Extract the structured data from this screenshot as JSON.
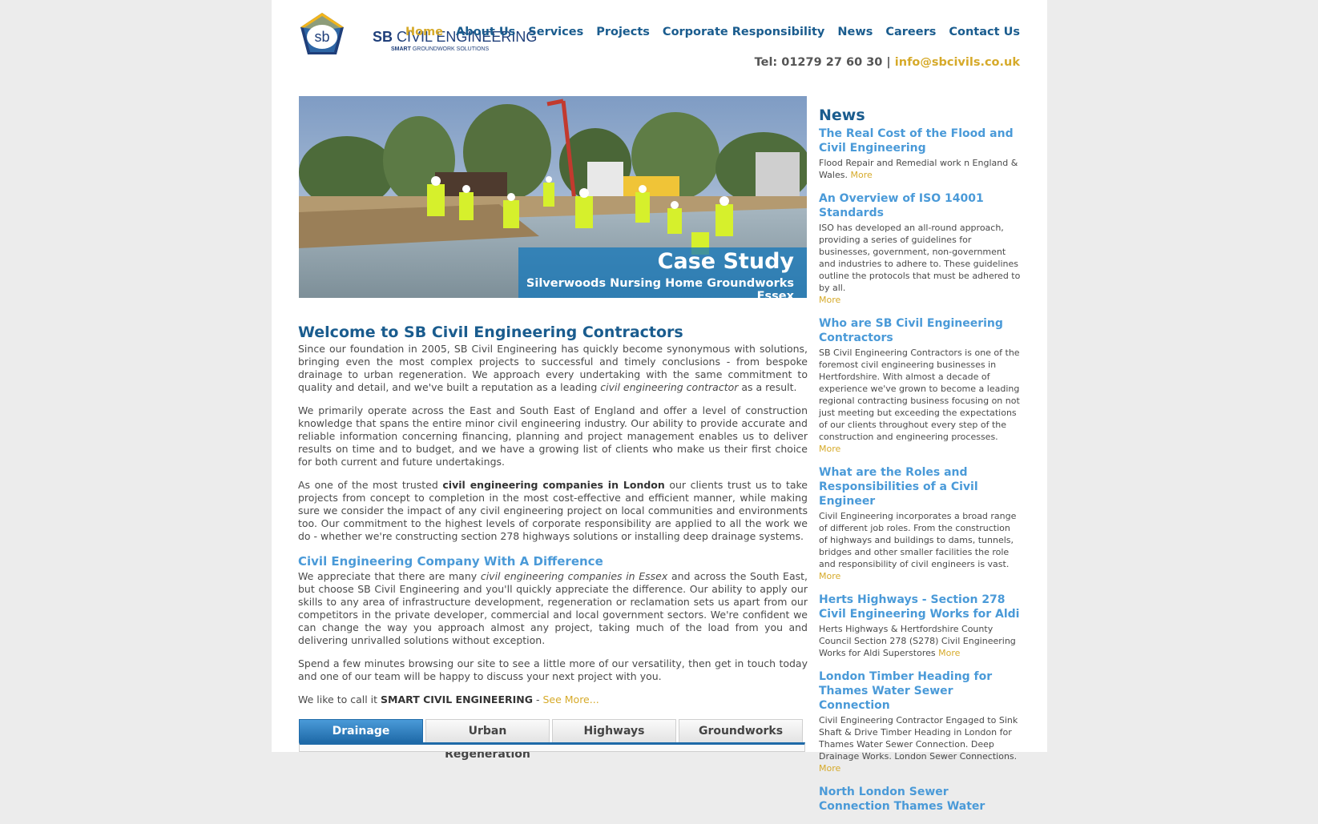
{
  "header": {
    "logo_mark": "sb",
    "logo_title_bold": "SB",
    "logo_title_rest": " CIVIL ENGINEERING",
    "logo_sub_bold": "SMART",
    "logo_sub_rest": " GROUNDWORK SOLUTIONS",
    "nav": [
      "Home",
      "About Us",
      "Services",
      "Projects",
      "Corporate Responsibility",
      "News",
      "Careers",
      "Contact Us"
    ],
    "tel": "Tel: 01279 27 60 30 |",
    "email": "info@sbcivils.co.uk"
  },
  "hero": {
    "title": "Case Study",
    "subtitle": "Silverwoods Nursing Home Groundworks Essex"
  },
  "main": {
    "heading": "Welcome to SB Civil Engineering Contractors",
    "p1_a": "Since our foundation in 2005, SB Civil Engineering has quickly become synonymous with solutions, bringing even the most complex projects to successful and timely conclusions - from bespoke drainage to urban regeneration. We approach every undertaking with the same commitment to quality and detail, and we've built a reputation as a leading ",
    "p1_i": "civil engineering contractor",
    "p1_b": " as a result.",
    "p2": "We primarily operate across the East and South East of England and offer a level of construction knowledge that spans the entire minor civil engineering industry. Our ability to provide accurate and reliable information concerning financing, planning and project management enables us to deliver results on time and to budget, and we have a growing list of clients who make us their first choice for both current and future undertakings.",
    "p3_a": "As one of the most trusted ",
    "p3_b": "civil engineering companies in London",
    "p3_c": " our clients trust us to take projects from concept to completion in the most cost-effective and efficient manner, while making sure we consider the impact of any civil engineering project on local communities and environments too. Our commitment to the highest levels of corporate responsibility are applied to all the work we do - whether we're constructing section 278 highways solutions or installing deep drainage systems.",
    "subheading": "Civil Engineering Company With A Difference",
    "p4_a": "We appreciate that there are many ",
    "p4_i": "civil engineering companies in Essex",
    "p4_b": " and across the South East, but choose SB Civil Engineering and you'll quickly appreciate the difference. Our ability to apply our skills to any area of infrastructure development, regeneration or reclamation sets us apart from our competitors in the private developer, commercial and local government sectors. We're confident we can change the way you approach almost any project, taking much of the load from you and delivering unrivalled solutions without exception.",
    "p5": "Spend a few minutes browsing our site to see a little more of our versatility, then get in touch today and one of our team will be happy to discuss your next project with you.",
    "p6_a": "We like to call it ",
    "p6_b": "SMART CIVIL ENGINEERING",
    "p6_c": " - ",
    "see_more": "See More..."
  },
  "tabs": [
    "Drainage",
    "Urban Regeneration",
    "Highways",
    "Groundworks"
  ],
  "sidebar": {
    "heading": "News",
    "more_label": "More",
    "items": [
      {
        "title": "The Real Cost of the Flood and Civil Engineering",
        "body": "Flood Repair and Remedial work n England & Wales."
      },
      {
        "title": "An Overview of ISO 14001 Standards",
        "body": "ISO has developed an all-round approach, providing a series of guidelines for businesses, government, non-government and industries to adhere to. These guidelines outline the protocols that must be adhered to by all."
      },
      {
        "title": "Who are SB Civil Engineering Contractors",
        "body": "SB Civil Engineering Contractors is one of the foremost civil engineering businesses in Hertfordshire. With almost a decade of experience we've grown to become a leading regional contracting business focusing on not just meeting but exceeding the expectations of our clients throughout every step of the construction and engineering processes."
      },
      {
        "title": "What are the Roles and Responsibilities of a Civil Engineer",
        "body": "Civil Engineering incorporates a broad range of different job roles. From the construction of highways and buildings to dams, tunnels, bridges and other smaller facilities the role and responsibility of civil engineers is vast."
      },
      {
        "title": "Herts Highways - Section 278 Civil Engineering Works for Aldi",
        "body": "Herts Highways & Hertfordshire County Council Section 278 (S278) Civil Engineering Works for Aldi Superstores"
      },
      {
        "title": "London Timber Heading for Thames Water Sewer Connection",
        "body": "Civil Engineering Contractor Engaged to Sink Shaft & Drive Timber Heading in London for Thames Water Sewer Connection. Deep Drainage Works. London Sewer Connections."
      },
      {
        "title": "North London Sewer Connection Thames Water",
        "body": ""
      }
    ]
  }
}
